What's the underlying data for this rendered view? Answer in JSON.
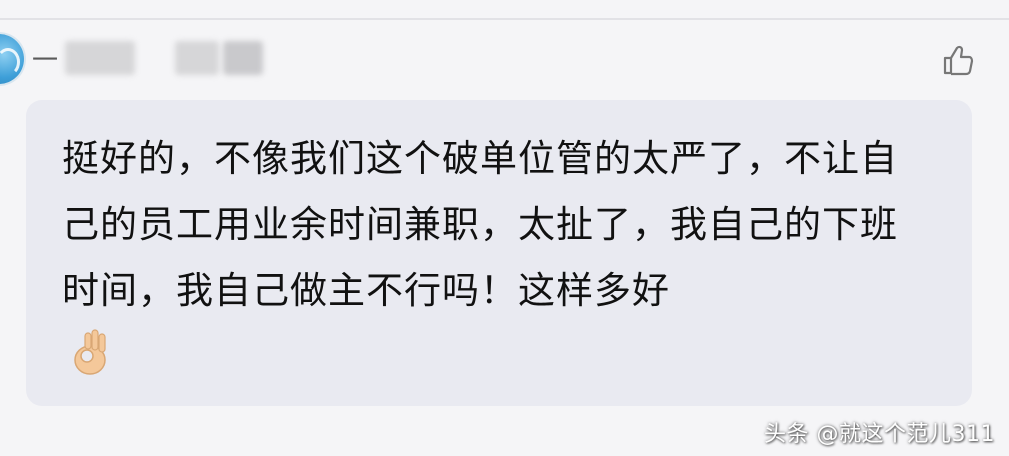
{
  "comment": {
    "username_visible": "一",
    "text": "挺好的，不像我们这个破单位管的太严了，不让自己的员工用业余时间兼职，太扯了，我自己的下班时间，我自己做主不行吗！这样多好",
    "emoji_icon": "ok-hand-icon"
  },
  "watermark": {
    "text": "头条 @就这个范儿311"
  },
  "colors": {
    "background": "#f5f5f7",
    "bubble": "#e9eaf1",
    "text": "#111111",
    "avatar": "#3e9fd8"
  }
}
